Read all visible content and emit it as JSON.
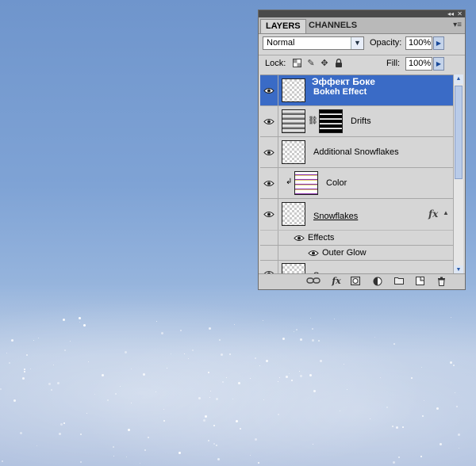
{
  "panel": {
    "tabs": [
      {
        "label": "LAYERS",
        "active": true
      },
      {
        "label": "CHANNELS",
        "active": false
      }
    ],
    "blend_mode": "Normal",
    "opacity_label": "Opacity:",
    "opacity_value": "100%",
    "lock_label": "Lock:",
    "fill_label": "Fill:",
    "fill_value": "100%"
  },
  "layers": [
    {
      "name": "Эффект Боке",
      "subtitle": "Bokeh Effect",
      "selected": true,
      "visible": true
    },
    {
      "name": "Drifts",
      "visible": true,
      "has_mask": true,
      "linked": true
    },
    {
      "name": "Additional Snowflakes",
      "visible": true
    },
    {
      "name": "Color",
      "visible": true,
      "clipped": true
    },
    {
      "name": "Snowflakes",
      "visible": true,
      "fx": "fx",
      "effects_label": "Effects",
      "effect_items": [
        "Outer Glow"
      ]
    },
    {
      "name": "S",
      "visible": true
    }
  ],
  "colors": {
    "selection": "#3a6bc6",
    "panel_bg": "#d6d6d6"
  },
  "icons": {
    "lock": [
      "lock-transparent-icon",
      "lock-paint-icon",
      "lock-move-icon",
      "lock-all-icon"
    ],
    "bottom": [
      "link-layers-icon",
      "fx-icon",
      "add-mask-icon",
      "adjustment-layer-icon",
      "new-group-icon",
      "new-layer-icon",
      "trash-icon"
    ]
  }
}
